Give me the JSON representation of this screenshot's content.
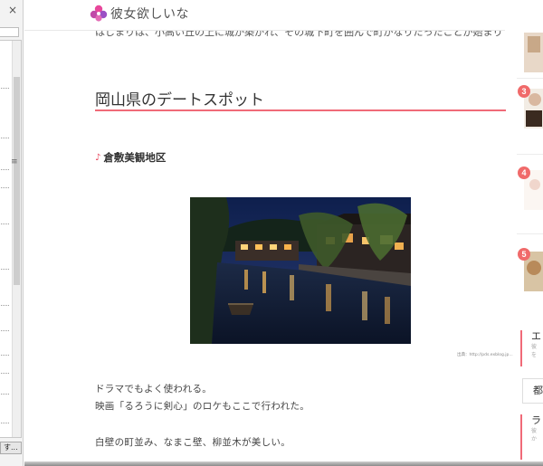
{
  "side_panel": {
    "close_glyph": "×",
    "grip_glyph": "≡",
    "bottom_button_label": "す..."
  },
  "header": {
    "site_name": "彼女欲しいな"
  },
  "article": {
    "cutoff_line": "はじまりは、小高い丘の上に城が築かれ、その城下町を囲んで町がなりたったことが始まりです。",
    "section_title": "岡山県のデートスポット",
    "spot_name": "倉敷美観地区",
    "photo_credit": "出典：http://pds.exblog.jp...",
    "paragraph_1_line_1": "ドラマでもよく使われる。",
    "paragraph_1_line_2": "映画「るろうに剣心」のロケもここで行われた。",
    "paragraph_2_line_1": "白壁の町並み、なまこ壁、柳並木が美しい。"
  },
  "sidebar": {
    "ranks": [
      "3",
      "4",
      "5"
    ],
    "block_1_heading": "エ",
    "block_1_sub_1": "彼",
    "block_1_sub_2": "を",
    "box_label": "都",
    "block_2_heading": "ラ",
    "block_2_sub_1": "彼",
    "block_2_sub_2": "か"
  },
  "colors": {
    "accent": "#f06a78",
    "logo_pink": "#e8479b",
    "logo_purple": "#9b4fc4"
  }
}
